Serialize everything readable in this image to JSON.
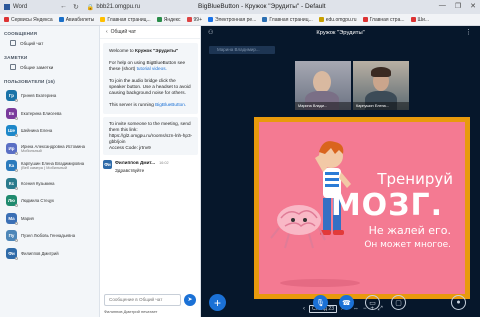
{
  "browser": {
    "app_name": "Word",
    "url": "bbb21.omgpu.ru",
    "page_title": "BigBlueButton - Кружок \"Эрудиты\" - Default",
    "nav": {
      "back": "←",
      "forward": "→",
      "reload": "↻"
    },
    "controls": {
      "minimize": "—",
      "maximize": "❐",
      "close": "✕"
    }
  },
  "bookmarks": [
    "Сервисы Яндекса",
    "Авиабилеты",
    "Главная страниц...",
    "Яндекс",
    "99+",
    "Электронная ре...",
    "Главная страниц...",
    "edu.omgpu.ru",
    "Главная стра...",
    "Ши..."
  ],
  "users_panel": {
    "messages_label": "СООБЩЕНИЯ",
    "public_chat": "Общий чат",
    "notes_label": "ЗАМЕТКИ",
    "shared_notes": "Общие заметки",
    "users_label": "ПОЛЬЗОВАТЕЛИ (16)",
    "users": [
      {
        "initials": "Гр",
        "name": "Гринев Екатерина",
        "sub": "",
        "color": "#1a73a8"
      },
      {
        "initials": "Ек",
        "name": "Екатерина Елисеева",
        "sub": "",
        "color": "#7a3b9c"
      },
      {
        "initials": "Ше",
        "name": "Шейнина Елена",
        "sub": "",
        "color": "#1e88c9"
      },
      {
        "initials": "Ир",
        "name": "Ирина Александровна Истомина",
        "sub": "Мобильный",
        "color": "#5a6fc4"
      },
      {
        "initials": "Ка",
        "name": "Карпушин Елена Владимировна",
        "sub": "(Веб камера ) Мобильный",
        "color": "#2b7bbd"
      },
      {
        "initials": "Кс",
        "name": "Ксения Кузьмина",
        "sub": "",
        "color": "#2a7a8c"
      },
      {
        "initials": "Лю",
        "name": "Людмила Стецук",
        "sub": "",
        "color": "#1f8a6e"
      },
      {
        "initials": "Ма",
        "name": "Мария",
        "sub": "",
        "color": "#3a6fb5"
      },
      {
        "initials": "Пу",
        "name": "Пузел Любовь Геннадьевна",
        "sub": "",
        "color": "#4d86b8"
      },
      {
        "initials": "Фи",
        "name": "Филиппов Дмитрий",
        "sub": "",
        "color": "#2e6aa8"
      }
    ]
  },
  "chat": {
    "back_label": "Общий чат",
    "welcome": {
      "greeting": "Welcome to",
      "room_name": "Кружок \"Эрудиты\"",
      "help_text": "For help on using BigBlueButton see these (short)",
      "help_link": "tutorial videos.",
      "audio_text": "To join the audio bridge click the speaker button. Use a headset to avoid causing background noise for others.",
      "running_text": "This server is running",
      "running_link": "BigBlueButton."
    },
    "invite": {
      "text": "To invite someone to the meeting, send them this link:",
      "link": "https://gl2.omgpu.ru/rooms/szn-lnh-hp3-gbb/join",
      "code": "Access Code: jrtnv9"
    },
    "message": {
      "initials": "Фи",
      "author": "Филиппов Дмит...",
      "time": "16:02",
      "text": "Здравствуйте"
    },
    "input_placeholder": "Сообщение в Общий чат",
    "send_icon": "➤",
    "typing_text": "Филиппов Дмитрий печатает"
  },
  "main": {
    "meeting_title": "Кружок \"Эрудиты\"",
    "speaker_tag": "Марина Владимир...",
    "videos": [
      {
        "label": "Марина Влади..."
      },
      {
        "label": "Карпушин Елена..."
      }
    ],
    "slide": {
      "line1": "Тренируй",
      "line2": "МОЗГ.",
      "line3": "Не жалей его.",
      "line4": "Он может многое."
    },
    "slide_page": "Слайд 23"
  }
}
